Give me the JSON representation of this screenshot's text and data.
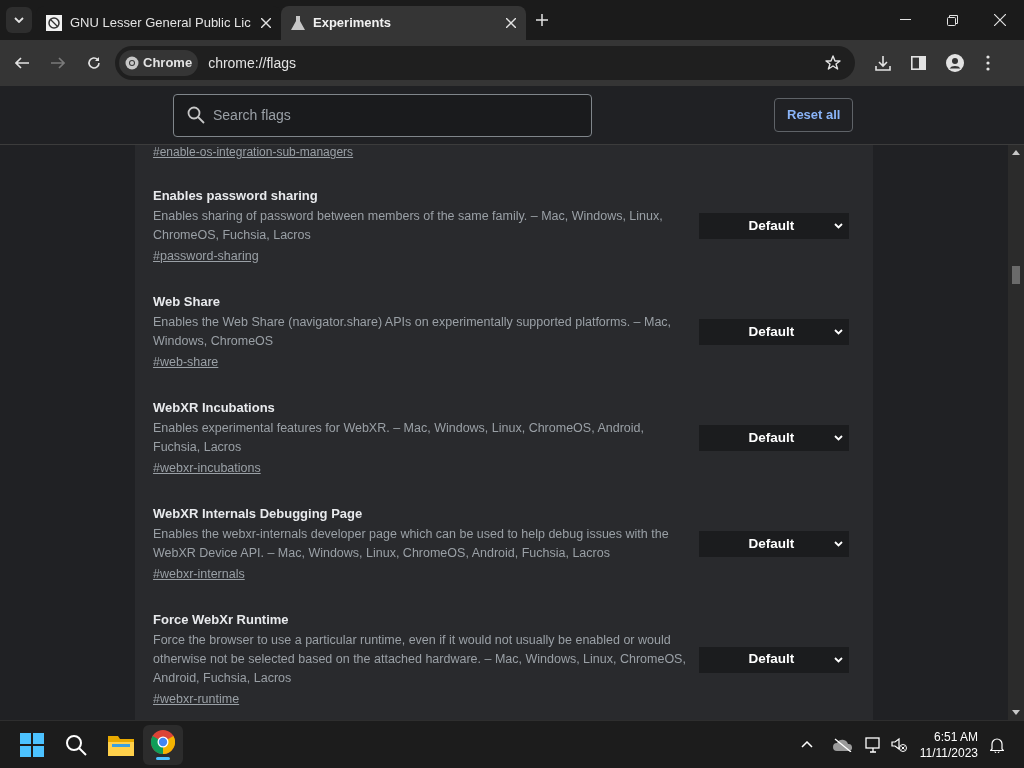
{
  "tabs": [
    {
      "title": "GNU Lesser General Public Lic",
      "selected": false
    },
    {
      "title": "Experiments",
      "selected": true
    }
  ],
  "address_bar": {
    "chip": "Chrome",
    "url": "chrome://flags"
  },
  "search": {
    "placeholder": "Search flags"
  },
  "reset_button": "Reset all",
  "top_link": "#enable-os-integration-sub-managers",
  "flags": [
    {
      "name": "Enables password sharing",
      "description": "Enables sharing of password between members of the same family. – Mac, Windows, Linux, ChromeOS, Fuchsia, Lacros",
      "link": "#password-sharing",
      "value": "Default"
    },
    {
      "name": "Web Share",
      "description": "Enables the Web Share (navigator.share) APIs on experimentally supported platforms. – Mac, Windows, ChromeOS",
      "link": "#web-share",
      "value": "Default"
    },
    {
      "name": "WebXR Incubations",
      "description": "Enables experimental features for WebXR. – Mac, Windows, Linux, ChromeOS, Android, Fuchsia, Lacros",
      "link": "#webxr-incubations",
      "value": "Default"
    },
    {
      "name": "WebXR Internals Debugging Page",
      "description": "Enables the webxr-internals developer page which can be used to help debug issues with the WebXR Device API. – Mac, Windows, Linux, ChromeOS, Android, Fuchsia, Lacros",
      "link": "#webxr-internals",
      "value": "Default"
    },
    {
      "name": "Force WebXr Runtime",
      "description": "Force the browser to use a particular runtime, even if it would not usually be enabled or would otherwise not be selected based on the attached hardware. – Mac, Windows, Linux, ChromeOS, Android, Fuchsia, Lacros",
      "link": "#webxr-runtime",
      "value": "Default"
    }
  ],
  "taskbar": {
    "time": "6:51 AM",
    "date": "11/11/2023"
  }
}
